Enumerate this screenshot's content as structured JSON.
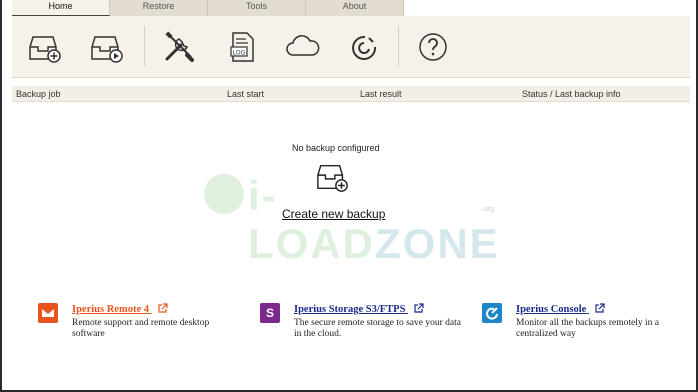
{
  "tabs": [
    {
      "label": "Home",
      "active": true
    },
    {
      "label": "Restore",
      "active": false
    },
    {
      "label": "Tools",
      "active": false
    },
    {
      "label": "About",
      "active": false
    }
  ],
  "ribbon": {
    "buttons": [
      {
        "icon": "new-backup-icon"
      },
      {
        "icon": "run-backup-icon"
      },
      {
        "icon": "tools-icon"
      },
      {
        "icon": "log-icon"
      },
      {
        "icon": "cloud-icon"
      },
      {
        "icon": "iperius-logo-icon"
      },
      {
        "icon": "help-icon"
      }
    ]
  },
  "columns": {
    "backup_job": "Backup job",
    "last_start": "Last start",
    "last_result": "Last result",
    "status": "Status / Last backup info"
  },
  "main": {
    "empty_message": "No backup configured",
    "create_link": "Create new backup"
  },
  "watermark": {
    "text_a": "i-LOAD",
    "text_b": "ZONE",
    "suffix": ".org"
  },
  "promos": [
    {
      "title": "Iperius Remote 4",
      "desc": "Remote support and remote desktop software",
      "color": "#e8561e",
      "title_color": "#e8561e"
    },
    {
      "title": "Iperius Storage S3/FTPS",
      "desc": "The secure remote storage to save your data in the cloud.",
      "color": "#7a2a8a",
      "title_color": "#1a2a8c"
    },
    {
      "title": "Iperius Console",
      "desc": "Monitor all the backups remotely in a centralized way",
      "color": "#1e86c8",
      "title_color": "#1a2a8c"
    }
  ],
  "colors": {
    "accent_orange": "#e8561e",
    "link_blue": "#1a2a8c",
    "ribbon_bg": "#f6f2ea"
  }
}
